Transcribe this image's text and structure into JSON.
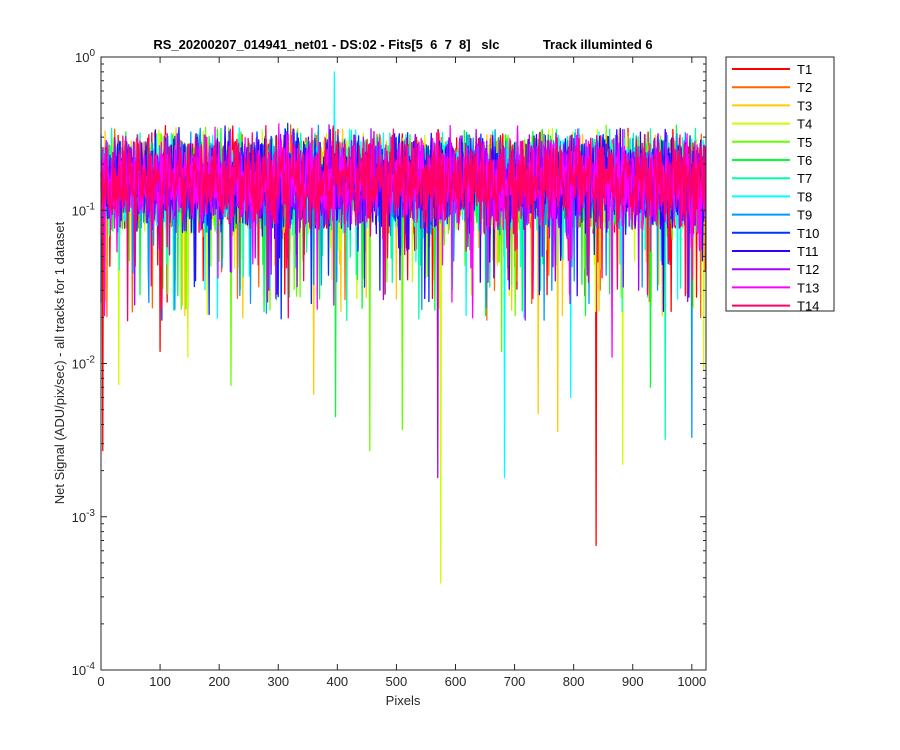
{
  "chart_data": {
    "type": "line",
    "title": "RS_20200207_014941_net01 - DS:02 - Fits[5  6  7  8]   slc            Track illuminted 6",
    "xlabel": "Pixels",
    "ylabel": "Net Signal (ADU/pix/sec) - all tracks for 1 dataset",
    "xlim": [
      0,
      1024
    ],
    "ylim": [
      0.0001,
      1
    ],
    "yscale": "log",
    "grid": false,
    "legend_position": "outside-right",
    "x_ticks": [
      {
        "value": 0,
        "label": "0"
      },
      {
        "value": 100,
        "label": "100"
      },
      {
        "value": 200,
        "label": "200"
      },
      {
        "value": 300,
        "label": "300"
      },
      {
        "value": 400,
        "label": "400"
      },
      {
        "value": 500,
        "label": "500"
      },
      {
        "value": 600,
        "label": "600"
      },
      {
        "value": 700,
        "label": "700"
      },
      {
        "value": 800,
        "label": "800"
      },
      {
        "value": 900,
        "label": "900"
      },
      {
        "value": 1000,
        "label": "1000"
      }
    ],
    "y_ticks": [
      {
        "value": 1,
        "base": "10",
        "exp": "0"
      },
      {
        "value": 0.1,
        "base": "10",
        "exp": "-1"
      },
      {
        "value": 0.01,
        "base": "10",
        "exp": "-2"
      },
      {
        "value": 0.001,
        "base": "10",
        "exp": "-3"
      },
      {
        "value": 0.0001,
        "base": "10",
        "exp": "-4"
      }
    ],
    "typical_range": [
      0.06,
      0.4
    ],
    "series": [
      {
        "name": "T1",
        "color": "#ff0000",
        "dips": [
          [
            3,
            0.0027
          ],
          [
            100,
            0.012
          ],
          [
            838,
            0.00065
          ],
          [
            1022,
            0.04
          ]
        ]
      },
      {
        "name": "T2",
        "color": "#ff6600",
        "dips": [
          [
            1015,
            0.02
          ]
        ]
      },
      {
        "name": "T3",
        "color": "#ffcc00",
        "dips": [
          [
            360,
            0.0063
          ],
          [
            740,
            0.0047
          ],
          [
            773,
            0.0036
          ]
        ]
      },
      {
        "name": "T4",
        "color": "#ccff00",
        "dips": [
          [
            30,
            0.0073
          ],
          [
            147,
            0.011
          ],
          [
            575,
            0.00037
          ],
          [
            883,
            0.0022
          ],
          [
            1020,
            0.009
          ]
        ]
      },
      {
        "name": "T5",
        "color": "#66ff00",
        "dips": [
          [
            220,
            0.0072
          ],
          [
            455,
            0.0027
          ],
          [
            510,
            0.0037
          ],
          [
            678,
            0.012
          ]
        ]
      },
      {
        "name": "T6",
        "color": "#00ff33",
        "dips": [
          [
            397,
            0.0045
          ],
          [
            930,
            0.007
          ]
        ]
      },
      {
        "name": "T7",
        "color": "#00ffaa",
        "dips": [
          [
            955,
            0.0032
          ]
        ]
      },
      {
        "name": "T8",
        "color": "#00ffff",
        "dips": [
          [
            395,
            0.8
          ],
          [
            683,
            0.0018
          ],
          [
            795,
            0.006
          ]
        ]
      },
      {
        "name": "T9",
        "color": "#0099ff",
        "dips": [
          [
            1000,
            0.0033
          ]
        ]
      },
      {
        "name": "T10",
        "color": "#0033ff",
        "dips": [
          [
            0,
            0.025
          ]
        ]
      },
      {
        "name": "T11",
        "color": "#3300ff",
        "dips": []
      },
      {
        "name": "T12",
        "color": "#aa00ff",
        "dips": [
          [
            570,
            0.0018
          ]
        ]
      },
      {
        "name": "T13",
        "color": "#ff00ff",
        "dips": [
          [
            865,
            0.011
          ]
        ]
      },
      {
        "name": "T14",
        "color": "#ff0066",
        "dips": []
      }
    ]
  }
}
